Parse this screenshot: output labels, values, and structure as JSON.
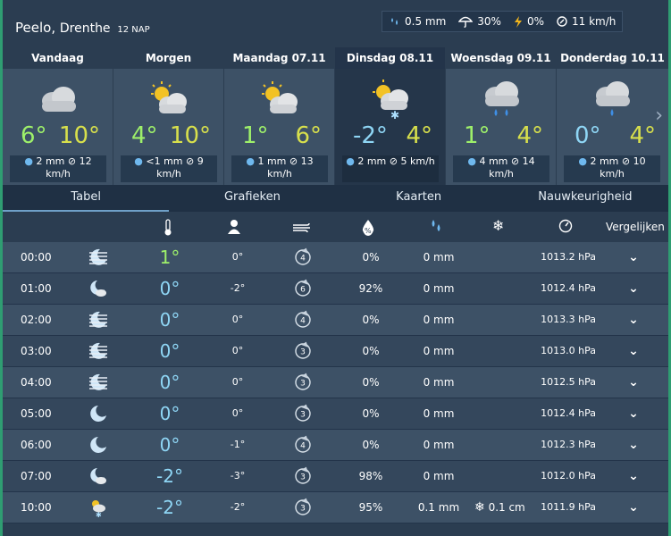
{
  "header": {
    "city": "Peelo",
    "region": "Drenthe",
    "altitude": "12 NAP",
    "summary": {
      "rain": "0.5 mm",
      "rain_chance": "30%",
      "thunder_chance": "0%",
      "wind": "11 km/h"
    }
  },
  "days": [
    {
      "name": "Vandaag",
      "icon": "cloud",
      "min": "6°",
      "max": "10°",
      "min_color": "#9ef06a",
      "rain": "2 mm",
      "wind": "12",
      "wind_unit": "km/h"
    },
    {
      "name": "Morgen",
      "icon": "sun-cloud",
      "min": "4°",
      "max": "10°",
      "min_color": "#9ef06a",
      "rain": "<1 mm",
      "wind": "9",
      "wind_unit": "km/h"
    },
    {
      "name": "Maandag 07.11",
      "icon": "sun-cloud",
      "min": "1°",
      "max": "6°",
      "min_color": "#9ef06a",
      "rain": "1 mm",
      "wind": "13",
      "wind_unit": "km/h"
    },
    {
      "name": "Dinsdag 08.11",
      "icon": "sun-cloud-snow",
      "min": "-2°",
      "max": "4°",
      "min_color": "#8fd6f5",
      "rain": "2 mm",
      "wind": "5 km/h",
      "wind_unit": ""
    },
    {
      "name": "Woensdag 09.11",
      "icon": "cloud-rain",
      "min": "1°",
      "max": "4°",
      "min_color": "#9ef06a",
      "rain": "4 mm",
      "wind": "14",
      "wind_unit": "km/h"
    },
    {
      "name": "Donderdag 10.11",
      "icon": "cloud-drop",
      "min": "0°",
      "max": "4°",
      "min_color": "#8fd6f5",
      "rain": "2 mm",
      "wind": "10",
      "wind_unit": "km/h"
    }
  ],
  "tabs": [
    "Tabel",
    "Grafieken",
    "Kaarten",
    "Nauwkeurigheid"
  ],
  "table_header": {
    "compare": "Vergelijken"
  },
  "rows": [
    {
      "time": "00:00",
      "icon": "night-fog",
      "temp": "1°",
      "temp_color": "#9ef06a",
      "feel": "0°",
      "wind": "4",
      "pct": "0%",
      "mm": "0 mm",
      "snow": "",
      "hpa": "1013.2 hPa"
    },
    {
      "time": "01:00",
      "icon": "moon-cloud",
      "temp": "0°",
      "temp_color": "#8fd6f5",
      "feel": "-2°",
      "wind": "6",
      "pct": "92%",
      "mm": "0 mm",
      "snow": "",
      "hpa": "1012.4 hPa"
    },
    {
      "time": "02:00",
      "icon": "night-fog",
      "temp": "0°",
      "temp_color": "#8fd6f5",
      "feel": "0°",
      "wind": "4",
      "pct": "0%",
      "mm": "0 mm",
      "snow": "",
      "hpa": "1013.3 hPa"
    },
    {
      "time": "03:00",
      "icon": "night-fog",
      "temp": "0°",
      "temp_color": "#8fd6f5",
      "feel": "0°",
      "wind": "3",
      "pct": "0%",
      "mm": "0 mm",
      "snow": "",
      "hpa": "1013.0 hPa"
    },
    {
      "time": "04:00",
      "icon": "night-fog",
      "temp": "0°",
      "temp_color": "#8fd6f5",
      "feel": "0°",
      "wind": "3",
      "pct": "0%",
      "mm": "0 mm",
      "snow": "",
      "hpa": "1012.5 hPa"
    },
    {
      "time": "05:00",
      "icon": "moon",
      "temp": "0°",
      "temp_color": "#8fd6f5",
      "feel": "0°",
      "wind": "3",
      "pct": "0%",
      "mm": "0 mm",
      "snow": "",
      "hpa": "1012.4 hPa"
    },
    {
      "time": "06:00",
      "icon": "moon",
      "temp": "0°",
      "temp_color": "#8fd6f5",
      "feel": "-1°",
      "wind": "4",
      "pct": "0%",
      "mm": "0 mm",
      "snow": "",
      "hpa": "1012.3 hPa"
    },
    {
      "time": "07:00",
      "icon": "moon-cloud",
      "temp": "-2°",
      "temp_color": "#8fd6f5",
      "feel": "-3°",
      "wind": "3",
      "pct": "98%",
      "mm": "0 mm",
      "snow": "",
      "hpa": "1012.0 hPa"
    },
    {
      "time": "10:00",
      "icon": "sun-cloud-snow",
      "temp": "-2°",
      "temp_color": "#8fd6f5",
      "feel": "-2°",
      "wind": "3",
      "pct": "95%",
      "mm": "0.1 mm",
      "snow": "0.1 cm",
      "hpa": "1011.9 hPa"
    }
  ]
}
